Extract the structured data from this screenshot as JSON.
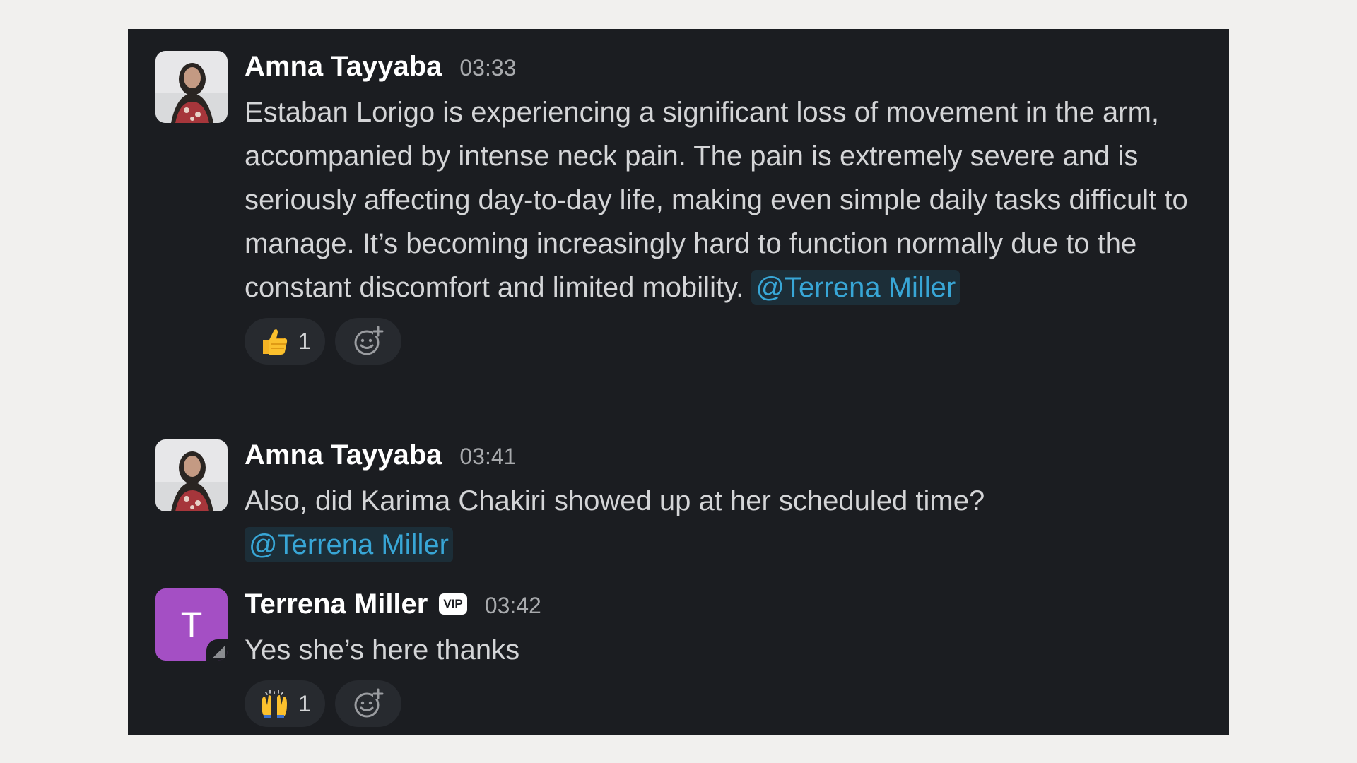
{
  "messages": [
    {
      "author": "Amna Tayyaba",
      "time": "03:33",
      "text": "Estaban Lorigo is experiencing a significant loss of movement in the arm, accompanied by intense neck pain. The pain is extremely severe and is seriously affecting day-to-day life, making even simple daily tasks difficult to manage. It’s becoming increasingly hard to function normally due to the constant discomfort and limited mobility.",
      "mention": "@Terrena Miller",
      "reaction": {
        "emoji": "thumbs-up",
        "count": "1"
      }
    },
    {
      "author": "Amna Tayyaba",
      "time": "03:41",
      "text": "Also, did Karima Chakiri showed up at her scheduled time?",
      "mention": "@Terrena Miller"
    },
    {
      "author": "Terrena Miller",
      "badge": "VIP",
      "avatar_letter": "T",
      "time": "03:42",
      "text": "Yes she’s here thanks",
      "reaction": {
        "emoji": "raising-hands",
        "count": "1"
      }
    }
  ],
  "colors": {
    "panel_bg": "#1b1d21",
    "mention": "#38a6d6",
    "avatar_purple": "#a44fc4"
  },
  "icons": [
    "add-reaction-icon",
    "thumbs-up-emoji",
    "raising-hands-emoji"
  ]
}
